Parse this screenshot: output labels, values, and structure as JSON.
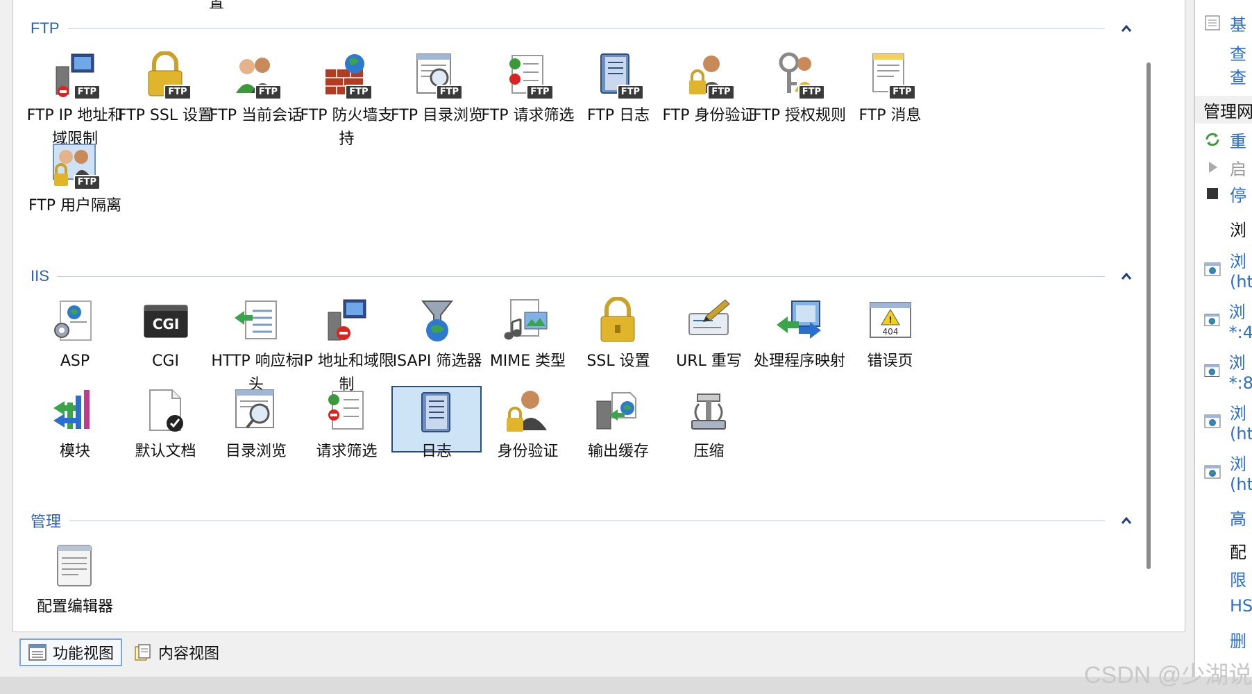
{
  "sections": {
    "ftp": {
      "title": "FTP",
      "tiles": [
        {
          "label": "FTP IP 地址和域限制",
          "icon": "ftp-ip-restrictions-icon"
        },
        {
          "label": "FTP SSL 设置",
          "icon": "ftp-ssl-icon"
        },
        {
          "label": "FTP 当前会话",
          "icon": "ftp-sessions-icon"
        },
        {
          "label": "FTP 防火墙支持",
          "icon": "ftp-firewall-icon"
        },
        {
          "label": "FTP 目录浏览",
          "icon": "ftp-directory-browsing-icon"
        },
        {
          "label": "FTP 请求筛选",
          "icon": "ftp-request-filtering-icon"
        },
        {
          "label": "FTP 日志",
          "icon": "ftp-logging-icon"
        },
        {
          "label": "FTP 身份验证",
          "icon": "ftp-authentication-icon"
        },
        {
          "label": "FTP 授权规则",
          "icon": "ftp-authorization-icon"
        },
        {
          "label": "FTP 消息",
          "icon": "ftp-messages-icon"
        },
        {
          "label": "FTP 用户隔离",
          "icon": "ftp-user-isolation-icon"
        }
      ]
    },
    "iis": {
      "title": "IIS",
      "tiles": [
        {
          "label": "ASP",
          "icon": "asp-icon"
        },
        {
          "label": "CGI",
          "icon": "cgi-icon"
        },
        {
          "label": "HTTP 响应标头",
          "icon": "http-headers-icon"
        },
        {
          "label": "IP 地址和域限制",
          "icon": "ip-restrictions-icon"
        },
        {
          "label": "ISAPI 筛选器",
          "icon": "isapi-filters-icon"
        },
        {
          "label": "MIME 类型",
          "icon": "mime-types-icon"
        },
        {
          "label": "SSL 设置",
          "icon": "ssl-icon"
        },
        {
          "label": "URL 重写",
          "icon": "url-rewrite-icon"
        },
        {
          "label": "处理程序映射",
          "icon": "handler-mappings-icon"
        },
        {
          "label": "错误页",
          "icon": "error-pages-icon"
        },
        {
          "label": "模块",
          "icon": "modules-icon"
        },
        {
          "label": "默认文档",
          "icon": "default-document-icon"
        },
        {
          "label": "目录浏览",
          "icon": "directory-browsing-icon"
        },
        {
          "label": "请求筛选",
          "icon": "request-filtering-icon"
        },
        {
          "label": "日志",
          "icon": "logging-icon",
          "selected": true
        },
        {
          "label": "身份验证",
          "icon": "authentication-icon"
        },
        {
          "label": "输出缓存",
          "icon": "output-caching-icon"
        },
        {
          "label": "压缩",
          "icon": "compression-icon"
        }
      ]
    },
    "management": {
      "title": "管理",
      "tiles": [
        {
          "label": "配置编辑器",
          "icon": "configuration-editor-icon"
        }
      ]
    }
  },
  "top_stub": "置",
  "bottom_tabs": {
    "features_view": "功能视图",
    "content_view": "内容视图"
  },
  "right_pane": {
    "items_top": [
      "基",
      "查",
      "查"
    ],
    "manage_header": "管理网",
    "actions": [
      {
        "text": "重",
        "state": "link"
      },
      {
        "text": "启",
        "state": "disabled"
      },
      {
        "text": "停",
        "state": "link"
      }
    ],
    "browse_header": "浏",
    "browse_items": [
      {
        "line1": "浏",
        "line2": "(ht"
      },
      {
        "line1": "浏",
        "line2": "*:4"
      },
      {
        "line1": "浏",
        "line2": "*:8"
      },
      {
        "line1": "浏",
        "line2": "(ht"
      },
      {
        "line1": "浏",
        "line2": "(ht"
      }
    ],
    "advanced": "高",
    "config_header": "配",
    "limits": "限",
    "hsts": "HS",
    "delete": "删"
  },
  "watermark": "CSDN @少湖说",
  "colors": {
    "section_title": "#2a5fb0",
    "selected_bg": "#cde4f7",
    "selected_border": "#2c4d77",
    "link": "#2a6fd0"
  }
}
